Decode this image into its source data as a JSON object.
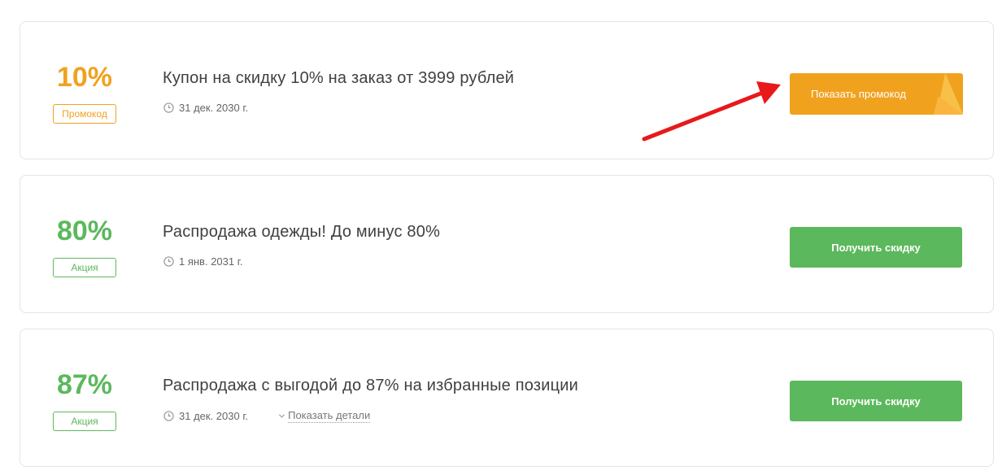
{
  "offers": [
    {
      "discount": "10%",
      "badge": "Промокод",
      "title": "Купон на скидку 10% на заказ от 3999 рублей",
      "date": "31 дек. 2030 г.",
      "button": "Показать промокод",
      "color": "#f0a21f"
    },
    {
      "discount": "80%",
      "badge": "Акция",
      "title": "Распродажа одежды! До минус 80%",
      "date": "1 янв. 2031 г.",
      "button": "Получить скидку",
      "color": "#5cb85c"
    },
    {
      "discount": "87%",
      "badge": "Акция",
      "title": "Распродажа с выгодой до 87% на избранные позиции",
      "date": "31 дек. 2030 г.",
      "details": "Показать детали",
      "button": "Получить скидку",
      "color": "#5cb85c"
    }
  ],
  "annotation": {
    "color": "#e8191b",
    "icon": "red-arrow-icon"
  },
  "icons": {
    "clock": "clock-icon",
    "chevron": "chevron-down-icon"
  }
}
